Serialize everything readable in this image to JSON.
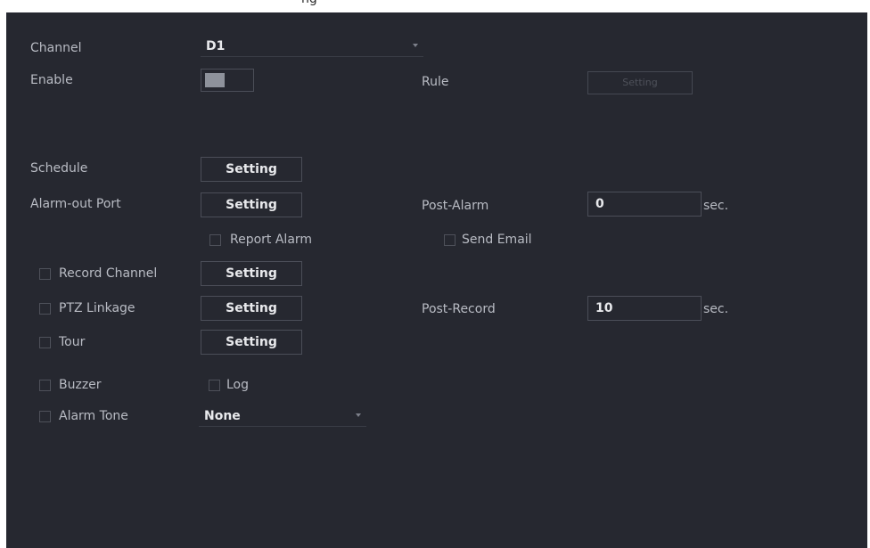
{
  "header": {
    "clipped_title": "ng"
  },
  "channel": {
    "label": "Channel",
    "value": "D1"
  },
  "enable": {
    "label": "Enable",
    "on": false
  },
  "rule": {
    "label": "Rule",
    "button_label": "Setting"
  },
  "schedule": {
    "label": "Schedule",
    "button_label": "Setting"
  },
  "alarm_out_port": {
    "label": "Alarm-out Port",
    "button_label": "Setting"
  },
  "post_alarm": {
    "label": "Post-Alarm",
    "value": "0",
    "unit": "sec."
  },
  "report_alarm": {
    "label": "Report Alarm",
    "checked": false
  },
  "send_email": {
    "label": "Send Email",
    "checked": false
  },
  "record_channel": {
    "label": "Record Channel",
    "checked": false,
    "button_label": "Setting"
  },
  "ptz_linkage": {
    "label": "PTZ Linkage",
    "checked": false,
    "button_label": "Setting"
  },
  "post_record": {
    "label": "Post-Record",
    "value": "10",
    "unit": "sec."
  },
  "tour": {
    "label": "Tour",
    "checked": false,
    "button_label": "Setting"
  },
  "buzzer": {
    "label": "Buzzer",
    "checked": false
  },
  "log": {
    "label": "Log",
    "checked": false
  },
  "alarm_tone": {
    "label": "Alarm Tone",
    "checked": false,
    "value": "None"
  },
  "colors": {
    "panel_bg": "#262830",
    "text": "#b9bcc4",
    "value_text": "#e8e9ec",
    "border": "#4b4e58"
  }
}
